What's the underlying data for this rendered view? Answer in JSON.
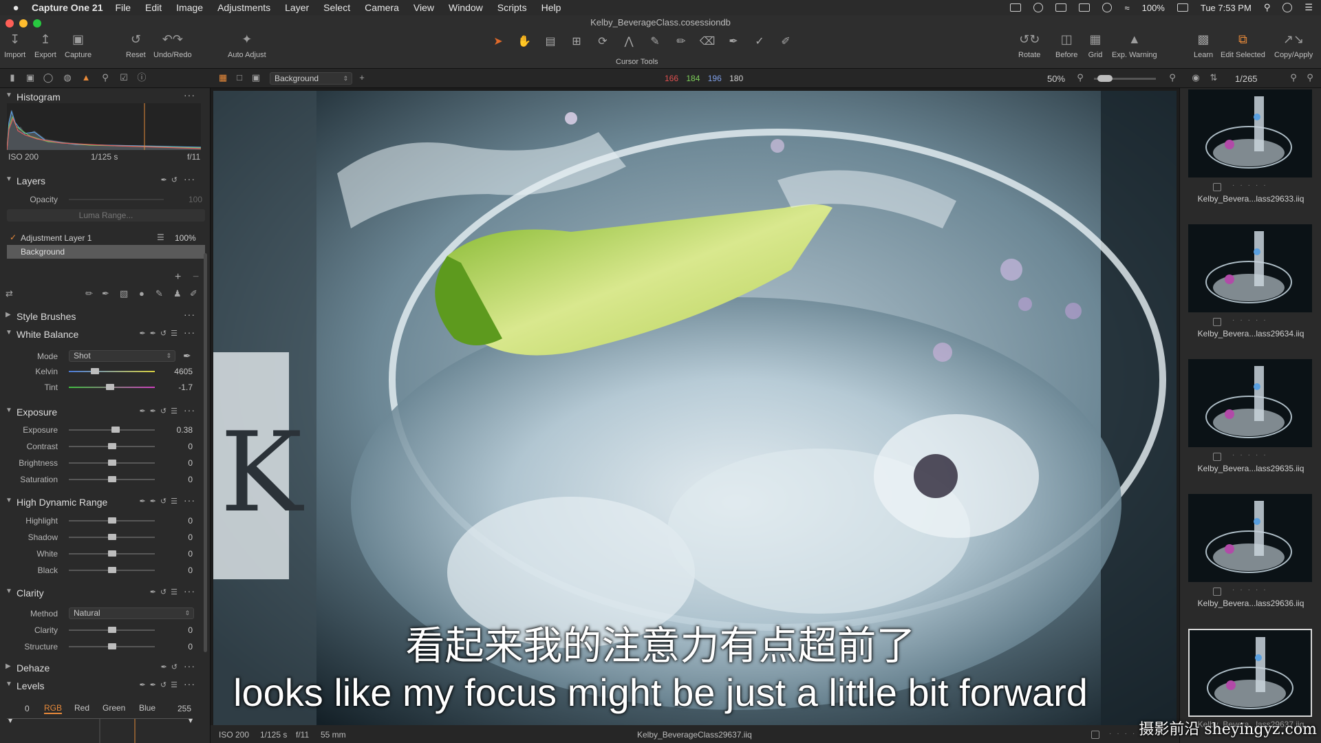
{
  "menubar": {
    "apple": "",
    "app_name": "Capture One 21",
    "items": [
      "File",
      "Edit",
      "Image",
      "Adjustments",
      "Layer",
      "Select",
      "Camera",
      "View",
      "Window",
      "Scripts",
      "Help"
    ],
    "battery": "100%",
    "clock": "Tue 7:53 PM"
  },
  "window": {
    "title": "Kelby_BeverageClass.cosessiondb"
  },
  "toolbar": {
    "import": "Import",
    "export": "Export",
    "capture": "Capture",
    "reset": "Reset",
    "undo_redo": "Undo/Redo",
    "auto_adjust": "Auto Adjust",
    "cursor_tools": "Cursor Tools",
    "rotate": "Rotate",
    "before": "Before",
    "grid": "Grid",
    "exp_warning": "Exp. Warning",
    "learn": "Learn",
    "edit_selected": "Edit Selected",
    "copy_apply": "Copy/Apply"
  },
  "subbar": {
    "variant": "Background",
    "rgb": {
      "r": "166",
      "g": "184",
      "b": "196",
      "l": "180"
    },
    "zoom": "50%",
    "counter": "1/265"
  },
  "histogram": {
    "title": "Histogram",
    "iso": "ISO 200",
    "shutter": "1/125 s",
    "aperture": "f/11"
  },
  "layers": {
    "title": "Layers",
    "opacity_label": "Opacity",
    "opacity_value": "100",
    "luma_range": "Luma Range...",
    "adjustment_layer": "Adjustment Layer 1",
    "adjustment_opacity": "100%",
    "background_layer": "Background"
  },
  "style_brushes": {
    "title": "Style Brushes"
  },
  "white_balance": {
    "title": "White Balance",
    "mode_label": "Mode",
    "mode_value": "Shot",
    "kelvin_label": "Kelvin",
    "kelvin_value": "4605",
    "tint_label": "Tint",
    "tint_value": "-1.7"
  },
  "exposure": {
    "title": "Exposure",
    "rows": [
      {
        "label": "Exposure",
        "value": "0.38",
        "level": 0.54
      },
      {
        "label": "Contrast",
        "value": "0",
        "level": 0.5
      },
      {
        "label": "Brightness",
        "value": "0",
        "level": 0.5
      },
      {
        "label": "Saturation",
        "value": "0",
        "level": 0.5
      }
    ]
  },
  "hdr": {
    "title": "High Dynamic Range",
    "rows": [
      {
        "label": "Highlight",
        "value": "0",
        "level": 0.5
      },
      {
        "label": "Shadow",
        "value": "0",
        "level": 0.5
      },
      {
        "label": "White",
        "value": "0",
        "level": 0.5
      },
      {
        "label": "Black",
        "value": "0",
        "level": 0.5
      }
    ]
  },
  "clarity": {
    "title": "Clarity",
    "method_label": "Method",
    "method_value": "Natural",
    "rows": [
      {
        "label": "Clarity",
        "value": "0",
        "level": 0.5
      },
      {
        "label": "Structure",
        "value": "0",
        "level": 0.5
      }
    ]
  },
  "dehaze": {
    "title": "Dehaze"
  },
  "levels": {
    "title": "Levels",
    "low": "0",
    "high": "255",
    "channels": [
      "RGB",
      "Red",
      "Green",
      "Blue"
    ]
  },
  "viewer_footer": {
    "iso": "ISO 200",
    "shutter": "1/125 s",
    "aperture": "f/11",
    "focal": "55 mm",
    "filename": "Kelby_BeverageClass29637.iiq"
  },
  "subtitles": {
    "chinese": "看起来我的注意力有点超前了",
    "english": "looks like my focus might be just a little bit forward"
  },
  "browser": {
    "thumbs": [
      {
        "name": "Kelby_Bevera...lass29633.iiq"
      },
      {
        "name": "Kelby_Bevera...lass29634.iiq"
      },
      {
        "name": "Kelby_Bevera...lass29635.iiq"
      },
      {
        "name": "Kelby_Bevera...lass29636.iiq"
      },
      {
        "name": "Kelby_Bevera...lass29637.iiq"
      }
    ]
  },
  "watermark": "摄影前沿 sheyingyz.com",
  "colors": {
    "accent": "#e06a2a",
    "red_readout": "#e05050",
    "green_readout": "#7ed05a",
    "blue_readout": "#7f9fe8",
    "levels_active": "#e88a3a"
  }
}
